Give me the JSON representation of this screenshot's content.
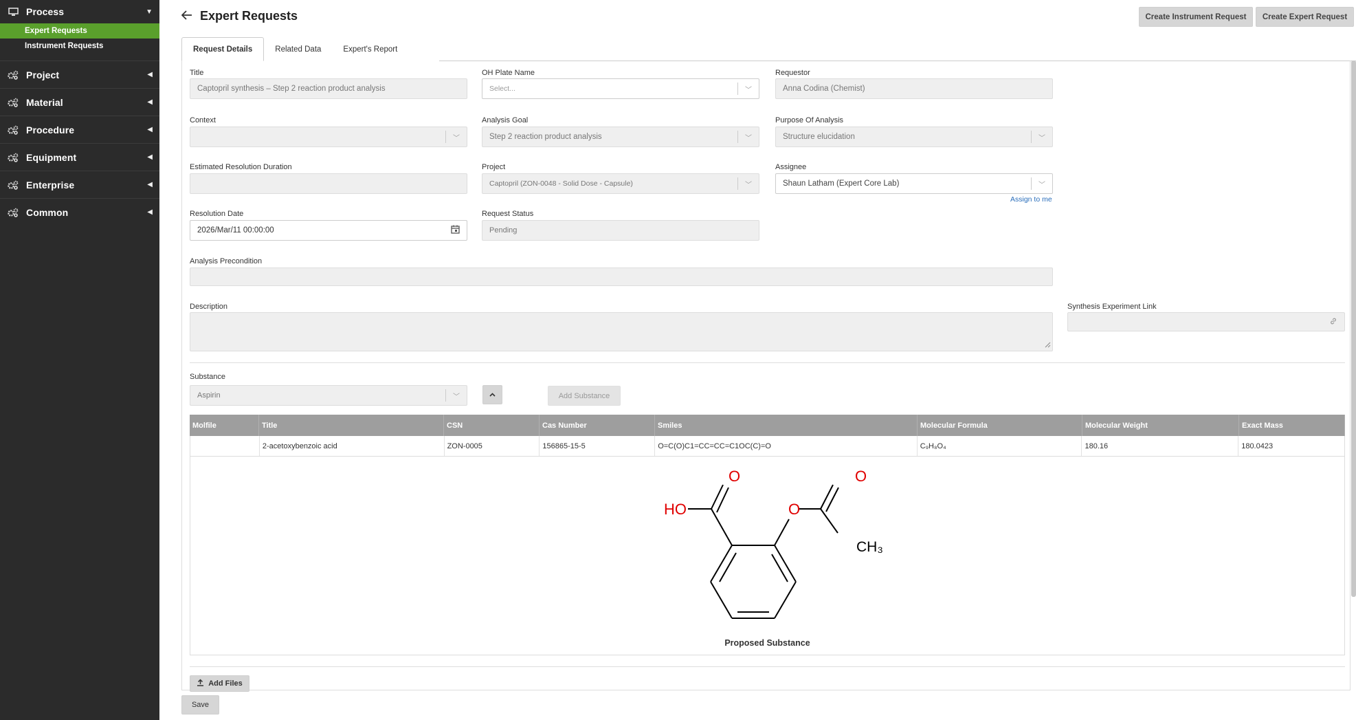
{
  "sidebar": {
    "groups": [
      {
        "label": "Process",
        "subitems": [
          {
            "label": "Expert Requests"
          },
          {
            "label": "Instrument Requests"
          }
        ]
      },
      {
        "label": "Project"
      },
      {
        "label": "Material"
      },
      {
        "label": "Procedure"
      },
      {
        "label": "Equipment"
      },
      {
        "label": "Enterprise"
      },
      {
        "label": "Common"
      }
    ]
  },
  "header": {
    "title": "Expert Requests",
    "create_instrument_label": "Create Instrument Request",
    "create_expert_label": "Create Expert Request"
  },
  "tabs": [
    {
      "label": "Request Details"
    },
    {
      "label": "Related Data"
    },
    {
      "label": "Expert's Report"
    }
  ],
  "form": {
    "title": {
      "label": "Title",
      "value": "Captopril synthesis – Step 2 reaction product analysis"
    },
    "oh_plate": {
      "label": "OH Plate Name",
      "placeholder": "Select..."
    },
    "requestor": {
      "label": "Requestor",
      "value": "Anna Codina (Chemist)"
    },
    "context": {
      "label": "Context",
      "value": ""
    },
    "analysis_goal": {
      "label": "Analysis Goal",
      "value": "Step 2 reaction product analysis"
    },
    "purpose": {
      "label": "Purpose Of Analysis",
      "value": "Structure elucidation"
    },
    "estimated_duration": {
      "label": "Estimated Resolution Duration",
      "value": ""
    },
    "project": {
      "label": "Project",
      "value": "Captopril (ZON-0048 - Solid Dose - Capsule)"
    },
    "assignee": {
      "label": "Assignee",
      "value": "Shaun Latham (Expert Core Lab)",
      "assign_link": "Assign to me"
    },
    "resolution_date": {
      "label": "Resolution Date",
      "value": "2026/Mar/11 00:00:00"
    },
    "request_status": {
      "label": "Request Status",
      "value": "Pending"
    },
    "analysis_precondition": {
      "label": "Analysis Precondition",
      "value": ""
    },
    "description": {
      "label": "Description",
      "value": ""
    },
    "synthesis_link": {
      "label": "Synthesis Experiment Link",
      "value": ""
    }
  },
  "substance": {
    "label": "Substance",
    "value": "Aspirin",
    "add_label": "Add Substance",
    "columns": [
      "Molfile",
      "Title",
      "CSN",
      "Cas Number",
      "Smiles",
      "Molecular Formula",
      "Molecular Weight",
      "Exact Mass"
    ],
    "rows": [
      {
        "molfile": "",
        "title": "2-acetoxybenzoic acid",
        "csn": "ZON-0005",
        "cas": "156865-15-5",
        "smiles": "O=C(O)C1=CC=CC=C1OC(C)=O",
        "formula": "C₉H₈O₄",
        "mw": "180.16",
        "exact_mass": "180.0423"
      }
    ],
    "structure_labels": {
      "o1": "O",
      "o2": "O",
      "o3": "O",
      "ho": "HO",
      "ch3": "CH₃"
    },
    "caption": "Proposed Substance"
  },
  "footer": {
    "add_files_label": "Add Files",
    "save_label": "Save"
  },
  "colors": {
    "accent": "#5aa02c",
    "sidebar": "#2b2b2b",
    "oxygen": "#e00000",
    "link": "#2a6ebb"
  },
  "icons": [
    "monitor-icon",
    "gears-icon",
    "caret-down-icon",
    "caret-left-icon",
    "back-arrow-icon",
    "calendar-icon",
    "chevron-down-icon",
    "chevron-up-icon",
    "link-icon",
    "upload-icon",
    "resize-handle-icon"
  ]
}
